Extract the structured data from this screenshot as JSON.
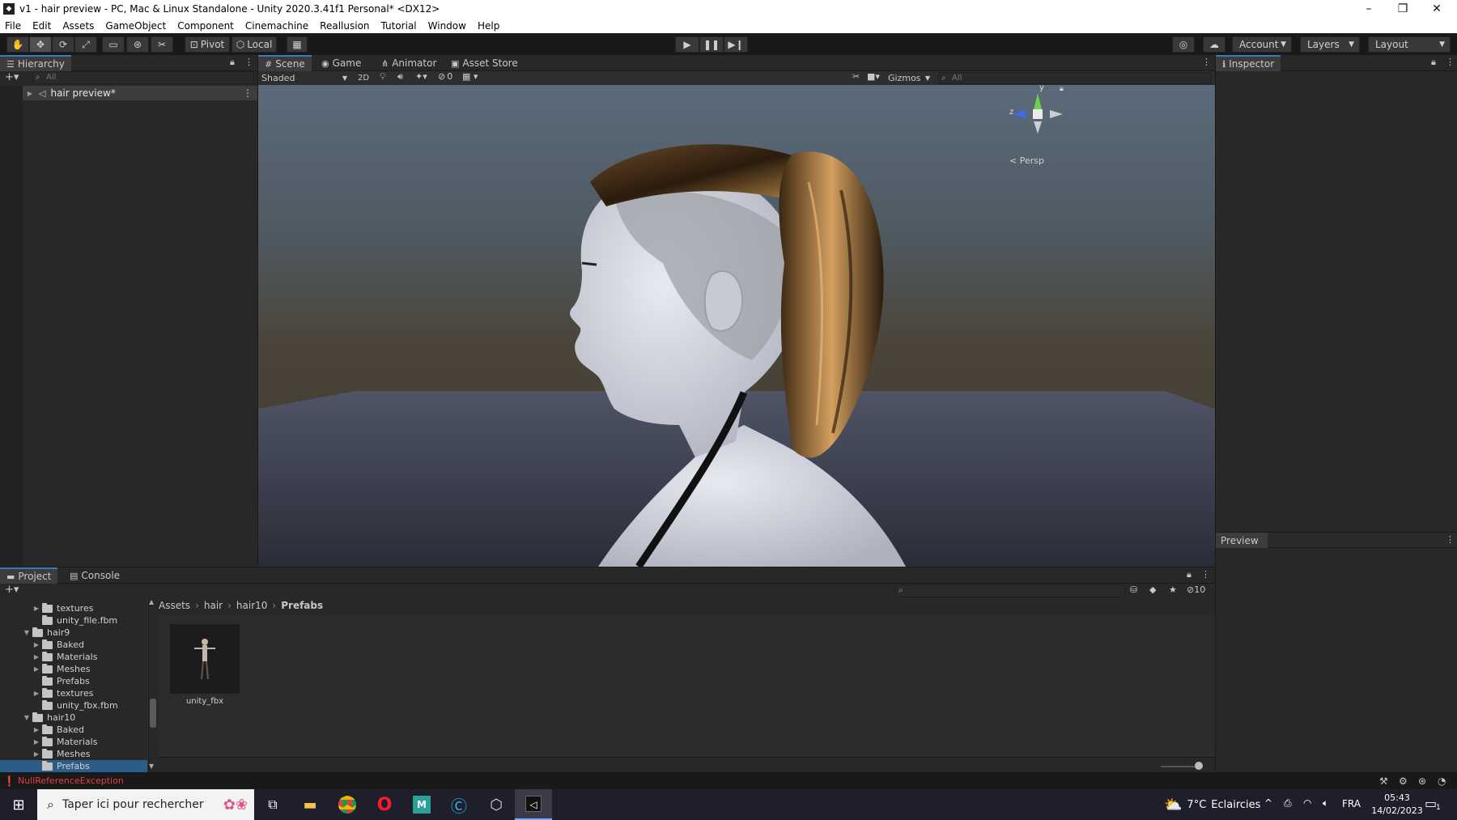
{
  "window": {
    "title": "v1 - hair preview - PC, Mac & Linux Standalone - Unity 2020.3.41f1 Personal* <DX12>"
  },
  "menu": [
    "File",
    "Edit",
    "Assets",
    "GameObject",
    "Component",
    "Cinemachine",
    "Reallusion",
    "Tutorial",
    "Window",
    "Help"
  ],
  "toolbar": {
    "pivot": "Pivot",
    "local": "Local",
    "account": "Account",
    "layers": "Layers",
    "layout": "Layout"
  },
  "hierarchy": {
    "tab": "Hierarchy",
    "search_placeholder": "All",
    "root_item": "hair preview*"
  },
  "scene": {
    "tabs": [
      "Scene",
      "Game",
      "Animator",
      "Asset Store"
    ],
    "shading": "Shaded",
    "mode_2d": "2D",
    "hidden_count": "0",
    "gizmos": "Gizmos",
    "search_placeholder": "All",
    "axis_y": "y",
    "axis_z": "z",
    "projection": "< Persp"
  },
  "inspector": {
    "tab": "Inspector",
    "preview": "Preview"
  },
  "project": {
    "tabs": [
      "Project",
      "Console"
    ],
    "hidden_count": "10",
    "breadcrumb": [
      "Assets",
      "hair",
      "hair10",
      "Prefabs"
    ],
    "tree": [
      {
        "label": "textures",
        "indent": 2,
        "arrow": "right"
      },
      {
        "label": "unity_file.fbm",
        "indent": 2,
        "arrow": ""
      },
      {
        "label": "hair9",
        "indent": 1,
        "arrow": "down"
      },
      {
        "label": "Baked",
        "indent": 2,
        "arrow": "right"
      },
      {
        "label": "Materials",
        "indent": 2,
        "arrow": "right"
      },
      {
        "label": "Meshes",
        "indent": 2,
        "arrow": "right"
      },
      {
        "label": "Prefabs",
        "indent": 2,
        "arrow": ""
      },
      {
        "label": "textures",
        "indent": 2,
        "arrow": "right"
      },
      {
        "label": "unity_fbx.fbm",
        "indent": 2,
        "arrow": ""
      },
      {
        "label": "hair10",
        "indent": 1,
        "arrow": "down"
      },
      {
        "label": "Baked",
        "indent": 2,
        "arrow": "right"
      },
      {
        "label": "Materials",
        "indent": 2,
        "arrow": "right"
      },
      {
        "label": "Meshes",
        "indent": 2,
        "arrow": "right"
      },
      {
        "label": "Prefabs",
        "indent": 2,
        "arrow": "",
        "selected": true
      }
    ],
    "asset": {
      "name": "unity_fbx"
    }
  },
  "status": {
    "error": "NullReferenceException"
  },
  "taskbar": {
    "search_placeholder": "Taper ici pour rechercher",
    "weather_temp": "7°C",
    "weather_desc": "Eclaircies",
    "language": "FRA",
    "time": "05:43",
    "date": "14/02/2023",
    "notifications": "1"
  },
  "colors": {
    "unity_dark": "#191919",
    "panel": "#282828",
    "selection": "#2c5d87",
    "accent_tab": "#3a79bb",
    "error": "#e04040",
    "taskbar": "#1f1f2b"
  }
}
